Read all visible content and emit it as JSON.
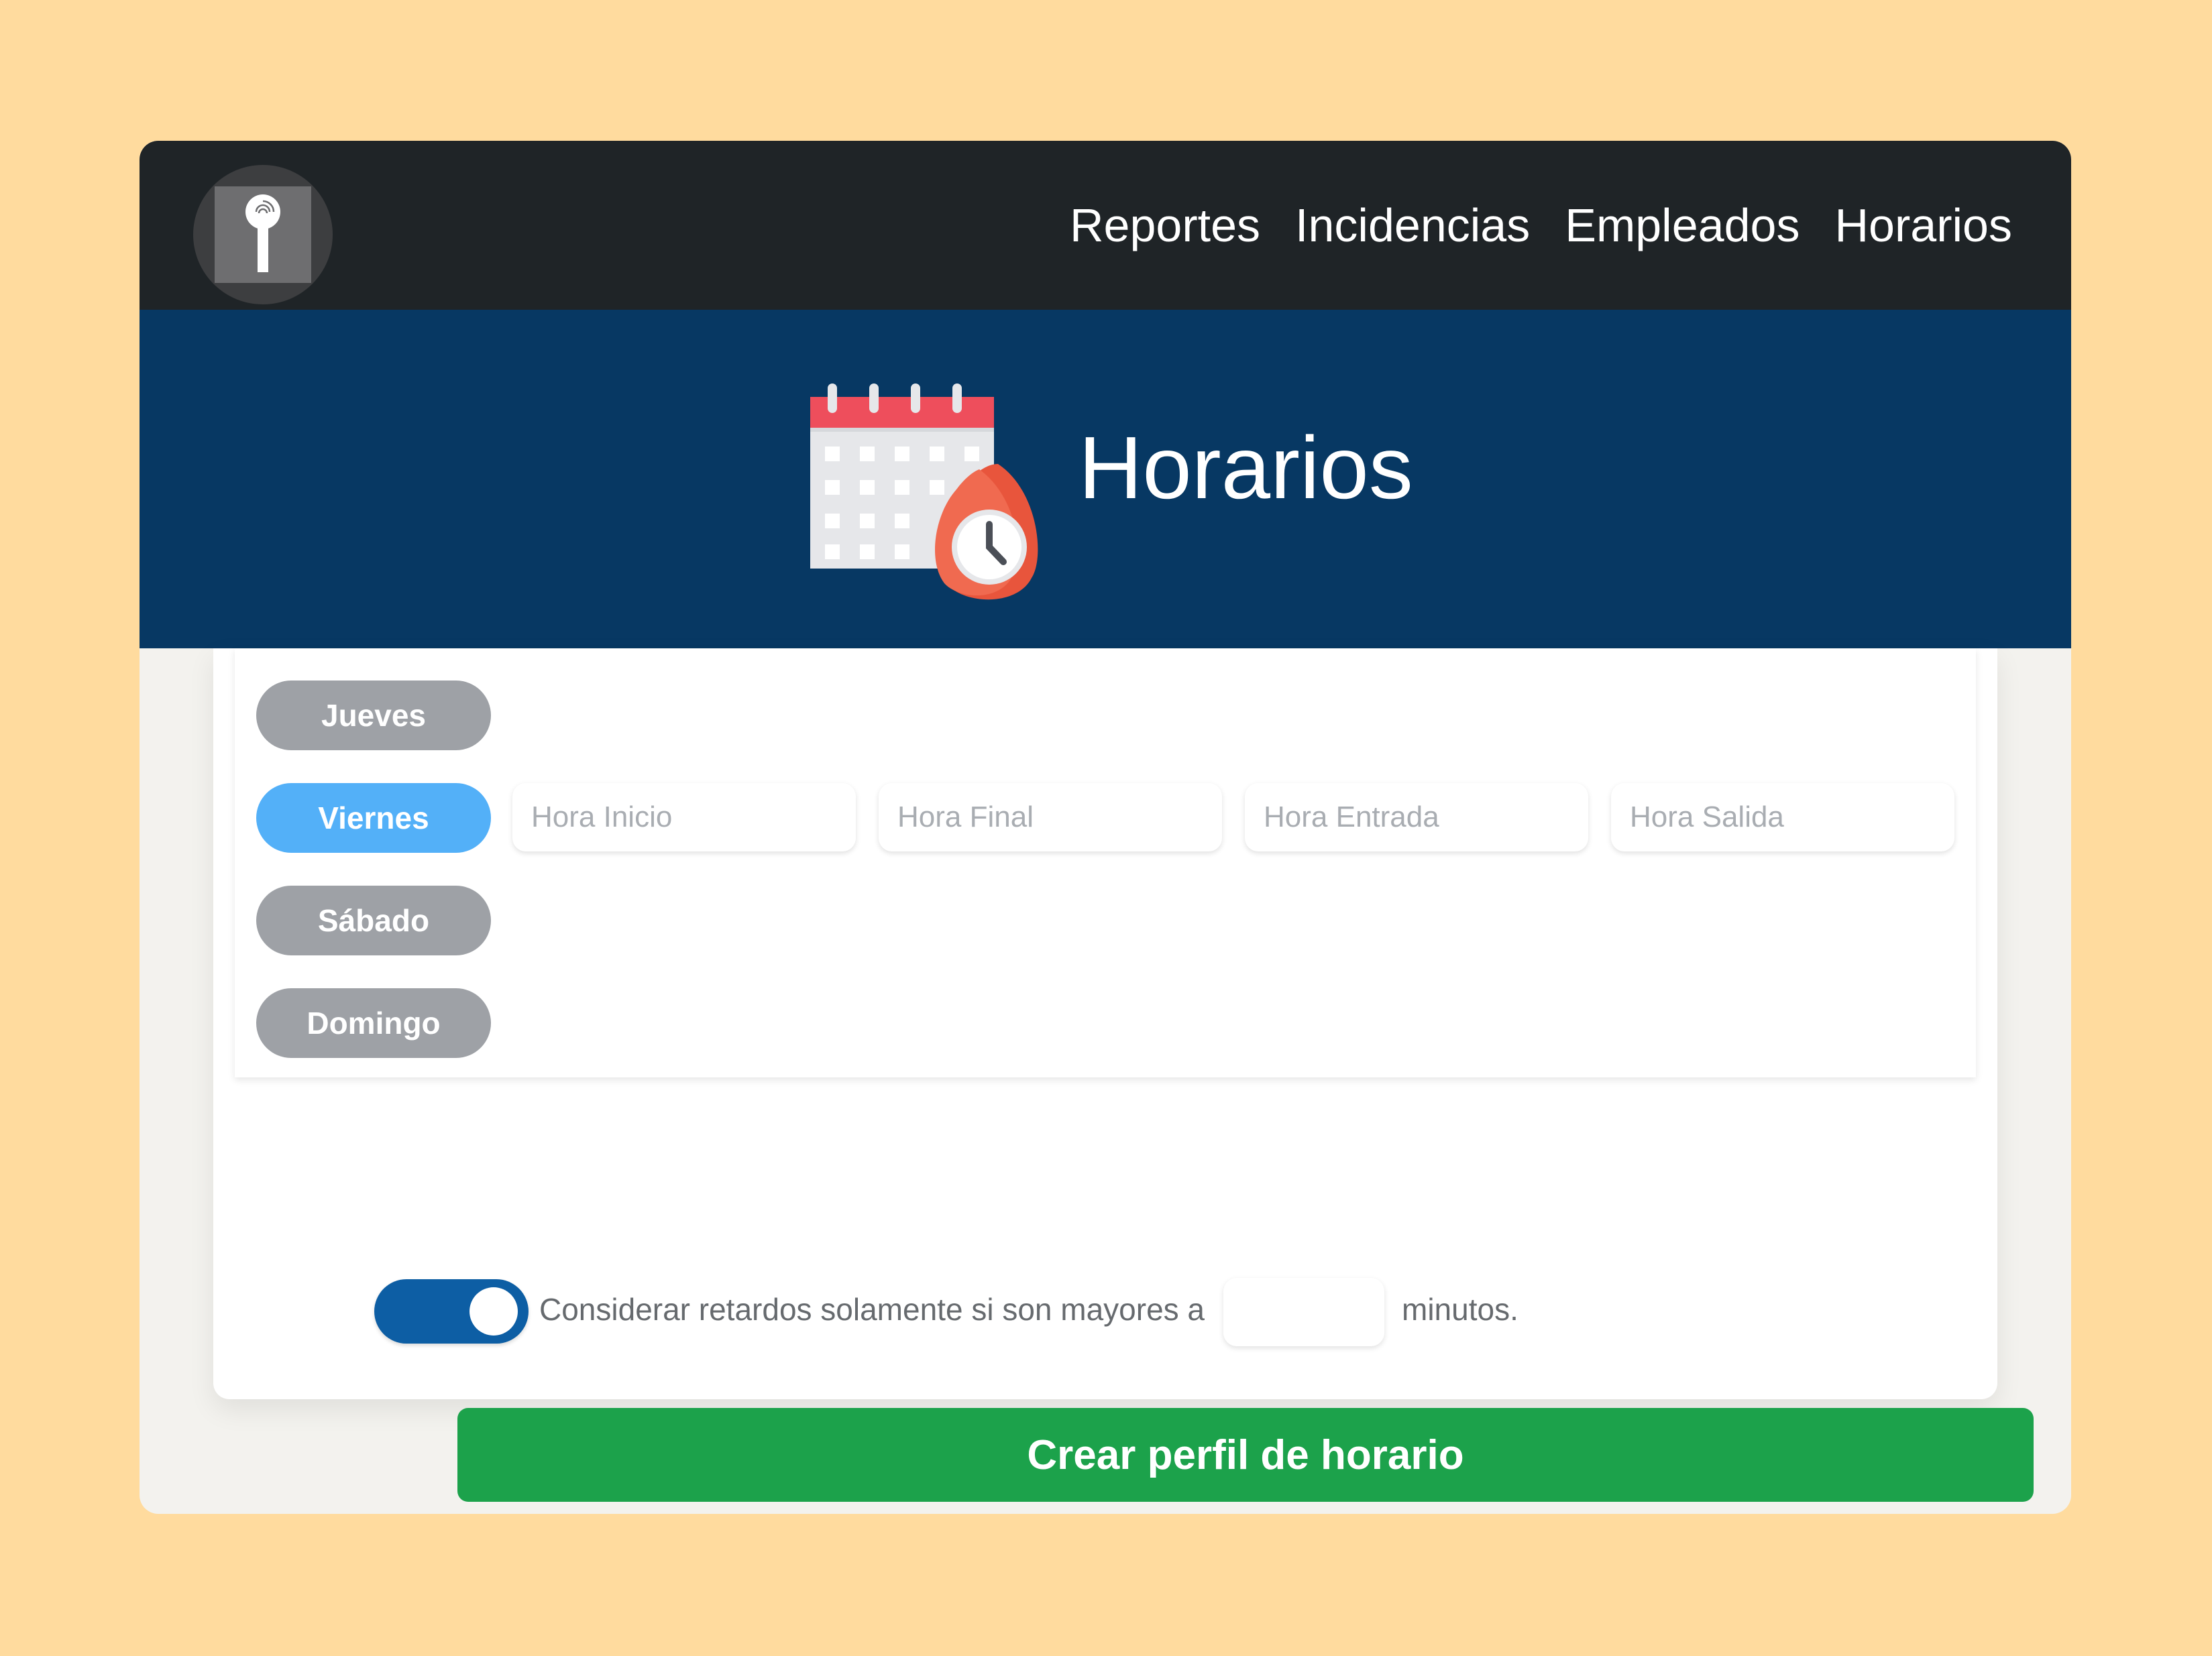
{
  "nav": {
    "links": [
      "Reportes",
      "Incidencias",
      "Empleados",
      "Horarios"
    ]
  },
  "hero": {
    "title": "Horarios",
    "icon": "calendar-clock-icon"
  },
  "days": [
    {
      "label": "Jueves",
      "active": false
    },
    {
      "label": "Viernes",
      "active": true
    },
    {
      "label": "Sábado",
      "active": false
    },
    {
      "label": "Domingo",
      "active": false
    }
  ],
  "time_fields": {
    "hora_inicio": {
      "placeholder": "Hora Inicio",
      "value": ""
    },
    "hora_final": {
      "placeholder": "Hora Final",
      "value": ""
    },
    "hora_entrada": {
      "placeholder": "Hora Entrada",
      "value": ""
    },
    "hora_salida": {
      "placeholder": "Hora Salida",
      "value": ""
    }
  },
  "retardos": {
    "toggle_on": true,
    "label": "Considerar retardos solamente si son mayores a",
    "minutes_value": "",
    "suffix": "minutos."
  },
  "actions": {
    "create_label": "Crear perfil de horario"
  },
  "colors": {
    "background": "#FFDB9E",
    "navbar": "#1F2427",
    "hero": "#073863",
    "day_inactive": "#9EA1A6",
    "day_active": "#53B0F8",
    "toggle": "#0D5EA4",
    "create_button": "#1CA24B"
  }
}
